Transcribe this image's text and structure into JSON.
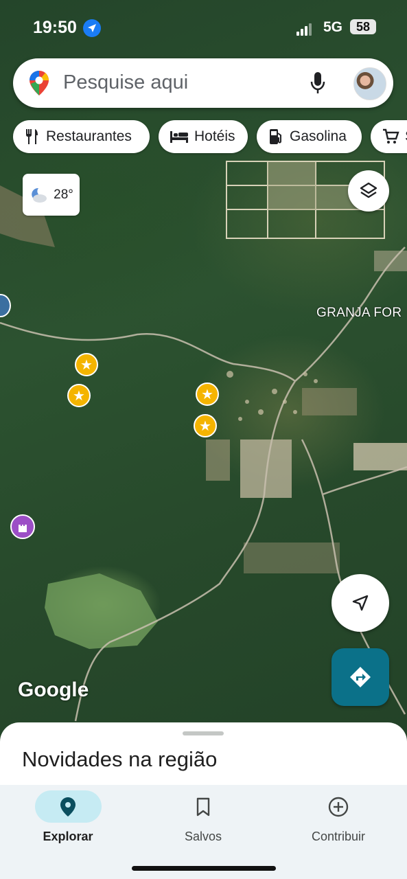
{
  "status_bar": {
    "time": "19:50",
    "network": "5G",
    "battery": "58"
  },
  "search": {
    "placeholder": "Pesquise aqui"
  },
  "chips": [
    {
      "label": "Restaurantes",
      "icon": "fork-knife-icon"
    },
    {
      "label": "Hotéis",
      "icon": "bed-icon"
    },
    {
      "label": "Gasolina",
      "icon": "gas-pump-icon"
    },
    {
      "label": "S",
      "icon": "cart-icon"
    }
  ],
  "weather": {
    "temp": "28°"
  },
  "map_labels": {
    "granja": "GRANJA FOR"
  },
  "watermark": "Google",
  "sheet": {
    "title": "Novidades na região"
  },
  "bottom_nav": [
    {
      "label": "Explorar",
      "icon": "explore-pin-icon",
      "active": true
    },
    {
      "label": "Salvos",
      "icon": "bookmark-icon",
      "active": false
    },
    {
      "label": "Contribuir",
      "icon": "add-circle-icon",
      "active": false
    }
  ],
  "colors": {
    "accent": "#0b7189",
    "star": "#f4b400",
    "active_pill": "#c6ebf3"
  }
}
